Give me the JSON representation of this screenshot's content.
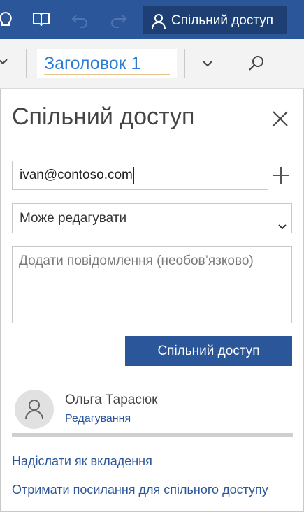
{
  "titlebar": {
    "share_label": "Спільний доступ"
  },
  "ribbon": {
    "style_value": "Заголовок 1"
  },
  "pane": {
    "title": "Спільний доступ",
    "email_value": "ivan@contoso.com",
    "permission_value": "Може редагувати",
    "message_placeholder": "Додати повідомлення (необов’язково)",
    "share_button": "Спільний доступ",
    "user": {
      "name": "Ольга Тарасюк",
      "role": "Редагування"
    },
    "links": {
      "send_attachment": "Надіслати як вкладення",
      "get_link": "Отримати посилання для спільного доступу"
    }
  },
  "colors": {
    "brand": "#2b579a",
    "brand_dark": "#1e3f73",
    "style_text": "#2b7cd3"
  }
}
